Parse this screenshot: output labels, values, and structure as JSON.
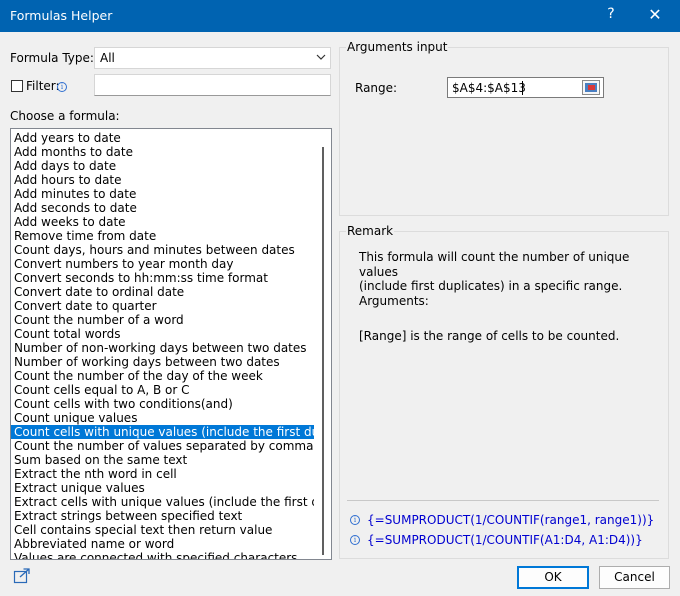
{
  "window": {
    "title": "Formulas Helper",
    "help_glyph": "?",
    "close_glyph": "✕"
  },
  "formula_type": {
    "label": "Formula Type:",
    "value": "All",
    "arrow_icon": "chevron-down-icon"
  },
  "filter": {
    "label": "Filter:",
    "checked": false,
    "info_icon": "info-icon",
    "value": ""
  },
  "choose": {
    "label": "Choose a formula:",
    "items": [
      "Add years to date",
      "Add months to date",
      "Add days to date",
      "Add hours to date",
      "Add minutes to date",
      "Add seconds to date",
      "Add weeks to date",
      "Remove time from date",
      "Count days, hours and minutes between dates",
      "Convert numbers to year month day",
      "Convert seconds to hh:mm:ss time format",
      "Convert date to ordinal date",
      "Convert date to quarter",
      "Count the number of a word",
      "Count total words",
      "Number of non-working days between two dates",
      "Number of working days between two dates",
      "Count the number of the day of the week",
      "Count cells equal to A, B or C",
      "Count cells with two conditions(and)",
      "Count unique values",
      "Count cells with unique values (include the first duplicate)",
      "Count the number of values separated by comma",
      "Sum based on the same text",
      "Extract the nth word in cell",
      "Extract unique values",
      "Extract cells with unique values (include the first duplicate)",
      "Extract strings between specified text",
      "Cell contains special text then return value",
      "Abbreviated name or word",
      "Values are connected with specified characters"
    ],
    "selected_index": 21
  },
  "arguments": {
    "group_label": "Arguments input",
    "range_label": "Range:",
    "range_value": "$A$4:$A$13",
    "range_button_icon": "range-select-icon"
  },
  "remark": {
    "group_label": "Remark",
    "line1": "This formula will count the number of unique values",
    "line2": "(include first duplicates) in a specific range.",
    "line3": "Arguments:",
    "line4": "[Range] is the range of cells to be counted.",
    "formula1": "{=SUMPRODUCT(1/COUNTIF(range1, range1))}",
    "formula2": "{=SUMPRODUCT(1/COUNTIF(A1:D4, A1:D4))}",
    "formula_icon": "info-icon"
  },
  "footer": {
    "export_icon": "external-link-icon",
    "ok_label": "OK",
    "cancel_label": "Cancel"
  },
  "colors": {
    "titlebar": "#0063b1",
    "selection": "#0078d7",
    "formula_text": "#0000d0"
  }
}
